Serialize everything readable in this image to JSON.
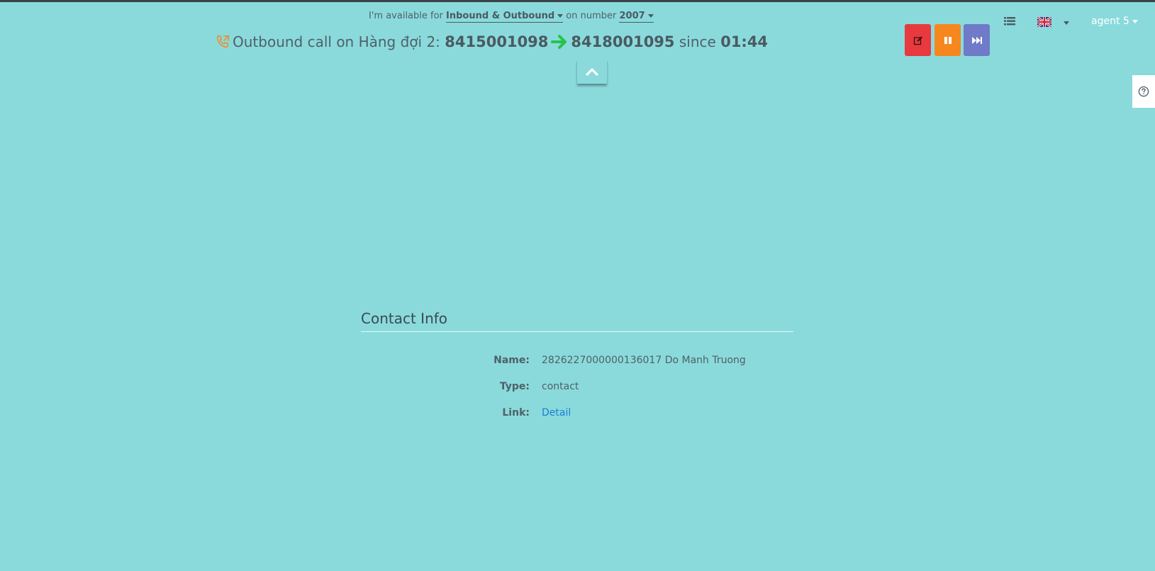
{
  "availability": {
    "prefix": "I'm available for",
    "mode": "Inbound & Outbound",
    "middle": "on number",
    "number": "2007"
  },
  "call": {
    "label": "Outbound call on Hàng đợi 2:",
    "from": "8415001098",
    "to": "8418001095",
    "since_label": "since",
    "duration": "01:44"
  },
  "header": {
    "agent_name": "agent 5",
    "language_flag": "uk-flag-icon"
  },
  "actions": {
    "note_icon": "edit-note-icon",
    "pause_icon": "pause-icon",
    "skip_icon": "skip-forward-icon"
  },
  "colors": {
    "background": "#8adadc",
    "red": "#e8393f",
    "orange": "#f6871f",
    "purple": "#6f7ac8",
    "link": "#1a7fd6",
    "arrow_green": "#27c24c"
  },
  "contact": {
    "title": "Contact Info",
    "rows": [
      {
        "label": "Name:",
        "value": "2826227000000136017 Do Manh Truong"
      },
      {
        "label": "Type:",
        "value": "contact"
      },
      {
        "label": "Link:",
        "value": "Detail"
      }
    ]
  }
}
